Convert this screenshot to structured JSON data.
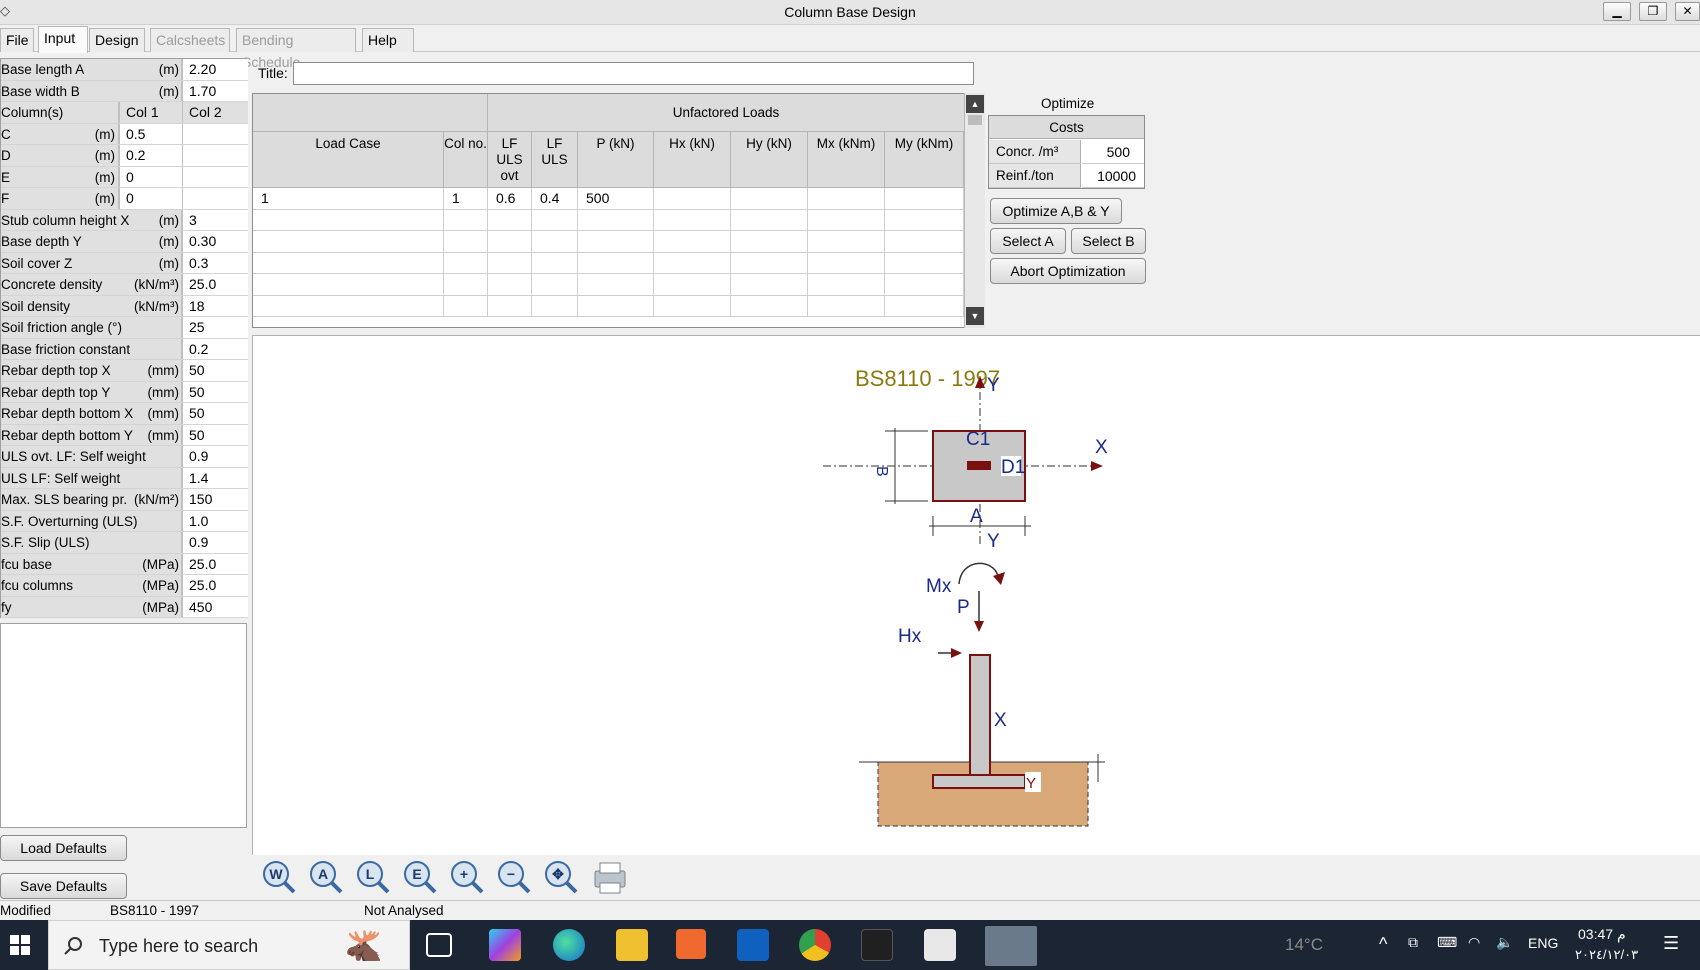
{
  "window": {
    "title": "Column Base Design",
    "controls": {
      "minimize": "▁",
      "restore": "❐",
      "close": "✕"
    }
  },
  "menu": {
    "items": [
      "File",
      "Input",
      "Design",
      "Calcsheets",
      "Bending Schedule",
      "Help"
    ],
    "active": "Input",
    "disabled": [
      "Calcsheets",
      "Bending Schedule"
    ]
  },
  "params": [
    {
      "label": "Base length A",
      "unit": "(m)",
      "value": "2.20"
    },
    {
      "label": "Base width B",
      "unit": "(m)",
      "value": "1.70"
    },
    {
      "label": "Column(s)",
      "unit": "",
      "col1": "Col 1",
      "col2": "Col 2",
      "header": true
    },
    {
      "label": "C",
      "unit": "(m)",
      "value": "0.5"
    },
    {
      "label": "D",
      "unit": "(m)",
      "value": "0.2"
    },
    {
      "label": "E",
      "unit": "(m)",
      "value": "0"
    },
    {
      "label": "F",
      "unit": "(m)",
      "value": "0"
    },
    {
      "label": "Stub column height X",
      "unit": "(m)",
      "value": "3"
    },
    {
      "label": "Base depth Y",
      "unit": "(m)",
      "value": "0.30"
    },
    {
      "label": "Soil cover Z",
      "unit": "(m)",
      "value": "0.3"
    },
    {
      "label": "Concrete density",
      "unit": "(kN/m³)",
      "value": "25.0"
    },
    {
      "label": "Soil density",
      "unit": "(kN/m³)",
      "value": "18"
    },
    {
      "label": "Soil friction angle (°)",
      "unit": "",
      "value": "25"
    },
    {
      "label": "Base friction constant",
      "unit": "",
      "value": "0.2"
    },
    {
      "label": "Rebar depth top X",
      "unit": "(mm)",
      "value": "50"
    },
    {
      "label": "Rebar depth top Y",
      "unit": "(mm)",
      "value": "50"
    },
    {
      "label": "Rebar depth bottom X",
      "unit": "(mm)",
      "value": "50"
    },
    {
      "label": "Rebar depth bottom Y",
      "unit": "(mm)",
      "value": "50"
    },
    {
      "label": "ULS ovt. LF: Self weight",
      "unit": "",
      "value": "0.9"
    },
    {
      "label": "ULS LF: Self weight",
      "unit": "",
      "value": "1.4"
    },
    {
      "label": "Max. SLS bearing pr.",
      "unit": "(kN/m²)",
      "value": "150"
    },
    {
      "label": "S.F. Overturning (ULS)",
      "unit": "",
      "value": "1.0"
    },
    {
      "label": "S.F. Slip (ULS)",
      "unit": "",
      "value": "0.9"
    },
    {
      "label": "fcu base",
      "unit": "(MPa)",
      "value": "25.0"
    },
    {
      "label": "fcu columns",
      "unit": "(MPa)",
      "value": "25.0"
    },
    {
      "label": "fy",
      "unit": "(MPa)",
      "value": "450"
    }
  ],
  "defaults": {
    "load": "Load Defaults",
    "save": "Save Defaults"
  },
  "title_field": {
    "label": "Title:",
    "value": ""
  },
  "loads": {
    "group_header": "Unfactored Loads",
    "columns": [
      "Load Case",
      "Col no.",
      "LF ULS ovt",
      "LF ULS",
      "P (kN)",
      "Hx (kN)",
      "Hy (kN)",
      "Mx (kNm)",
      "My (kNm)"
    ],
    "rows": [
      [
        "1",
        "1",
        "0.6",
        "0.4",
        "500",
        "",
        "",
        "",
        ""
      ]
    ]
  },
  "optimize": {
    "label": "Optimize",
    "costs_header": "Costs",
    "concr_label": "Concr.   /m³",
    "concr_value": "500",
    "reinf_label": "Reinf./ton",
    "reinf_value": "10000",
    "buttons": {
      "optimize": "Optimize A,B & Y",
      "select_a": "Select A",
      "select_b": "Select B",
      "abort": "Abort Optimization"
    }
  },
  "drawing": {
    "code": "BS8110 - 1997",
    "labels": {
      "x": "X",
      "y": "Y",
      "a": "A",
      "b": "B",
      "c1": "C1",
      "d1": "D1",
      "mx": "Mx",
      "p": "P",
      "hx": "Hx",
      "x2": "X",
      "y2": "Y"
    },
    "colors": {
      "code": "#8a7a10",
      "label": "#1a2a8a",
      "outline": "#7a1010",
      "soil": "#d8a878",
      "base": "#c8c8c8"
    }
  },
  "tools": [
    "W",
    "A",
    "L",
    "E",
    "+",
    "−",
    "✥",
    "print"
  ],
  "status": {
    "left": "Modified",
    "code": "BS8110 - 1997",
    "analysis": "Not Analysed"
  },
  "taskbar": {
    "search_placeholder": "Type here to search",
    "weather": "14°C",
    "lang": "ENG",
    "time": "03:47 م",
    "date": "٢٠٢٤/١٢/٠٣"
  }
}
